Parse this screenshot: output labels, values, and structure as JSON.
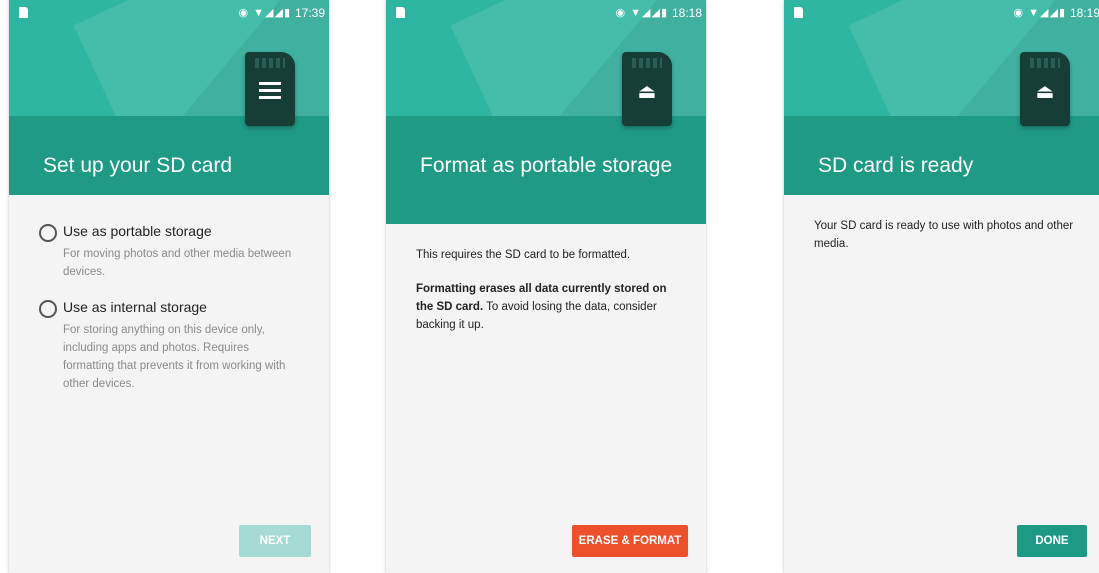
{
  "screens": [
    {
      "status_time": "17:39",
      "title": "Set up your SD card",
      "options": [
        {
          "label": "Use as portable storage",
          "description": "For moving photos and other media between devices."
        },
        {
          "label": "Use as internal storage",
          "description": "For storing anything on this device only, including apps and photos. Requires formatting that prevents it from working with other devices."
        }
      ],
      "button": "NEXT"
    },
    {
      "status_time": "18:18",
      "title": "Format as portable storage",
      "text1": "This requires the SD card to be formatted.",
      "text2_bold": "Formatting erases all data currently stored on the SD card.",
      "text2_rest": " To avoid losing the data, consider backing it up.",
      "button": "ERASE & FORMAT"
    },
    {
      "status_time": "18:19",
      "title": "SD card is ready",
      "text": "Your SD card is ready to use with photos and other media.",
      "button": "DONE"
    }
  ],
  "status_icons": "◉ ▼◢◢▮",
  "sd_icons": {
    "setup": "list-icon",
    "eject": "⏏"
  },
  "colors": {
    "header_dark": "#1f9a85",
    "header_light": "#2fb6a2",
    "erase_button": "#ec512b",
    "done_button": "#1c9a85",
    "next_button": "#a6dbd4"
  }
}
